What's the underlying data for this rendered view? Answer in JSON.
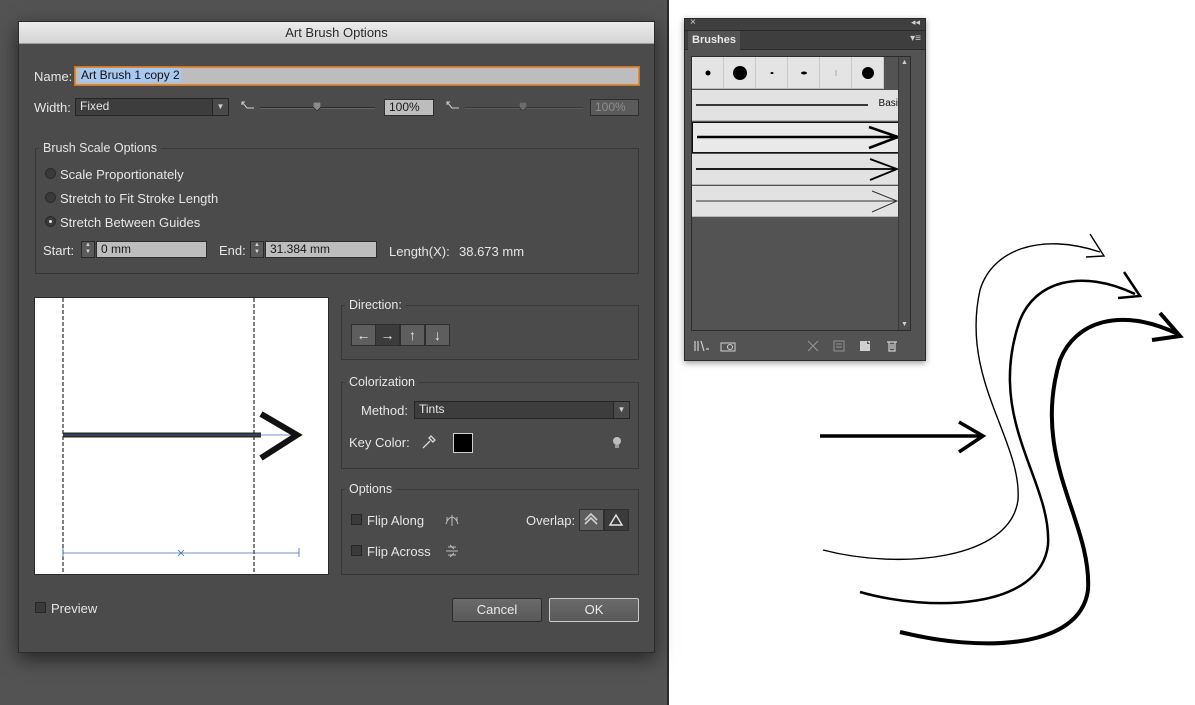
{
  "dialog": {
    "title": "Art Brush Options",
    "name_label": "Name:",
    "name_value": "Art Brush 1 copy 2",
    "width_label": "Width:",
    "width_value": "Fixed",
    "width_percent": "100%",
    "width_percent_disabled": "100%",
    "brush_scale": {
      "title": "Brush Scale Options",
      "options": [
        {
          "label": "Scale Proportionately",
          "checked": false
        },
        {
          "label": "Stretch to Fit Stroke Length",
          "checked": false
        },
        {
          "label": "Stretch Between Guides",
          "checked": true
        }
      ],
      "start_label": "Start:",
      "start_value": "0 mm",
      "end_label": "End:",
      "end_value": "31.384 mm",
      "length_label": "Length(X):",
      "length_value": "38.673 mm"
    },
    "direction": {
      "title": "Direction:",
      "buttons": [
        "←",
        "→",
        "↑",
        "↓"
      ],
      "selected": "→"
    },
    "colorization": {
      "title": "Colorization",
      "method_label": "Method:",
      "method_value": "Tints",
      "key_color_label": "Key Color:",
      "key_color": "#000000"
    },
    "options": {
      "title": "Options",
      "flip_along_label": "Flip Along",
      "flip_across_label": "Flip Across",
      "overlap_label": "Overlap:"
    },
    "preview_label": "Preview",
    "cancel_label": "Cancel",
    "ok_label": "OK"
  },
  "brushes_panel": {
    "tab_label": "Brushes",
    "basic_label": "Basic",
    "icons": [
      "close-icon",
      "collapse-icon",
      "panel-menu-icon",
      "brush-libraries-icon",
      "open-library-icon",
      "remove-stroke-icon",
      "brush-options-icon",
      "new-brush-icon",
      "delete-brush-icon"
    ]
  },
  "colors": {
    "app_background": "#535353",
    "dialog_background": "#4b4b4b",
    "name_focus": "#d98a3c",
    "artboard": "#ffffff"
  }
}
